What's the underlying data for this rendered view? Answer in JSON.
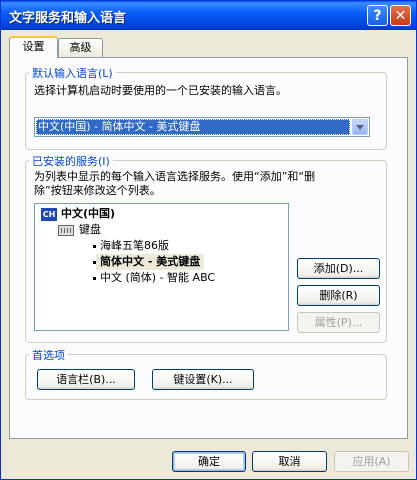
{
  "window": {
    "title": "文字服务和输入语言",
    "help_label": "?",
    "close_label": "✕"
  },
  "tabs": [
    {
      "label": "设置"
    },
    {
      "label": "高级"
    }
  ],
  "default_language": {
    "group_label": "默认输入语言(L)",
    "description": "选择计算机启动时要使用的一个已安装的输入语言。",
    "selected_value": "中文(中国) - 简体中文 - 美式键盘"
  },
  "installed_services": {
    "group_label": "已安装的服务(I)",
    "description_line1": "为列表中显示的每个输入语言选择服务。使用“添加”和“删",
    "description_line2": "除”按钮来修改这个列表。",
    "tree": {
      "language_badge": "CH",
      "language": "中文(中国)",
      "category": "键盘",
      "items": [
        {
          "label": "海峰五笔86版"
        },
        {
          "label": "简体中文 - 美式键盘"
        },
        {
          "label": "中文 (简体) - 智能 ABC"
        }
      ]
    },
    "add_button": "添加(D)...",
    "remove_button": "删除(R)",
    "properties_button": "属性(P)..."
  },
  "preferences": {
    "group_label": "首选项",
    "language_bar_button": "语言栏(B)...",
    "key_settings_button": "键设置(K)..."
  },
  "footer": {
    "ok_button": "确定",
    "cancel_button": "取消",
    "apply_button": "应用(A)"
  },
  "colors": {
    "title_bar": "#0a5ef8",
    "selection": "#316ac5",
    "group_label": "#0046d5",
    "face": "#ece9d8"
  }
}
